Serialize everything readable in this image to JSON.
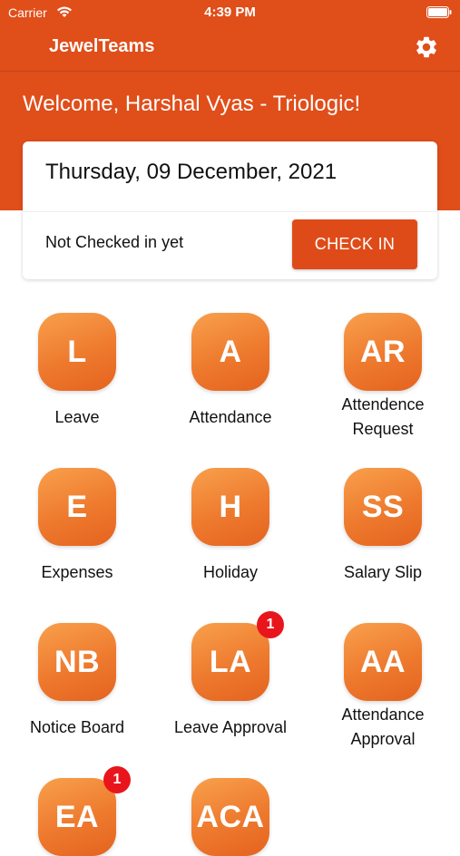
{
  "status_bar": {
    "carrier": "Carrier",
    "time": "4:39 PM"
  },
  "app": {
    "title": "JewelTeams",
    "settings_icon": "gear-icon",
    "accent": "#e04e1a"
  },
  "welcome": "Welcome, Harshal Vyas - Triologic!",
  "attendance_card": {
    "date": "Thursday, 09 December, 2021",
    "status": "Not Checked in yet",
    "button_label": "CHECK IN"
  },
  "tiles": [
    {
      "initials": "L",
      "label_lines": [
        "Leave"
      ]
    },
    {
      "initials": "A",
      "label_lines": [
        "Attendance"
      ]
    },
    {
      "initials": "AR",
      "label_lines": [
        "Attendence",
        "Request"
      ]
    },
    {
      "initials": "E",
      "label_lines": [
        "Expenses"
      ]
    },
    {
      "initials": "H",
      "label_lines": [
        "Holiday"
      ]
    },
    {
      "initials": "SS",
      "label_lines": [
        "Salary Slip"
      ]
    },
    {
      "initials": "NB",
      "label_lines": [
        "Notice Board"
      ]
    },
    {
      "initials": "LA",
      "label_lines": [
        "Leave Approval"
      ],
      "badge": "1"
    },
    {
      "initials": "AA",
      "label_lines": [
        "Attendance",
        "Approval"
      ]
    },
    {
      "initials": "EA",
      "label_lines": [],
      "badge": "1"
    },
    {
      "initials": "ACA",
      "label_lines": []
    }
  ]
}
